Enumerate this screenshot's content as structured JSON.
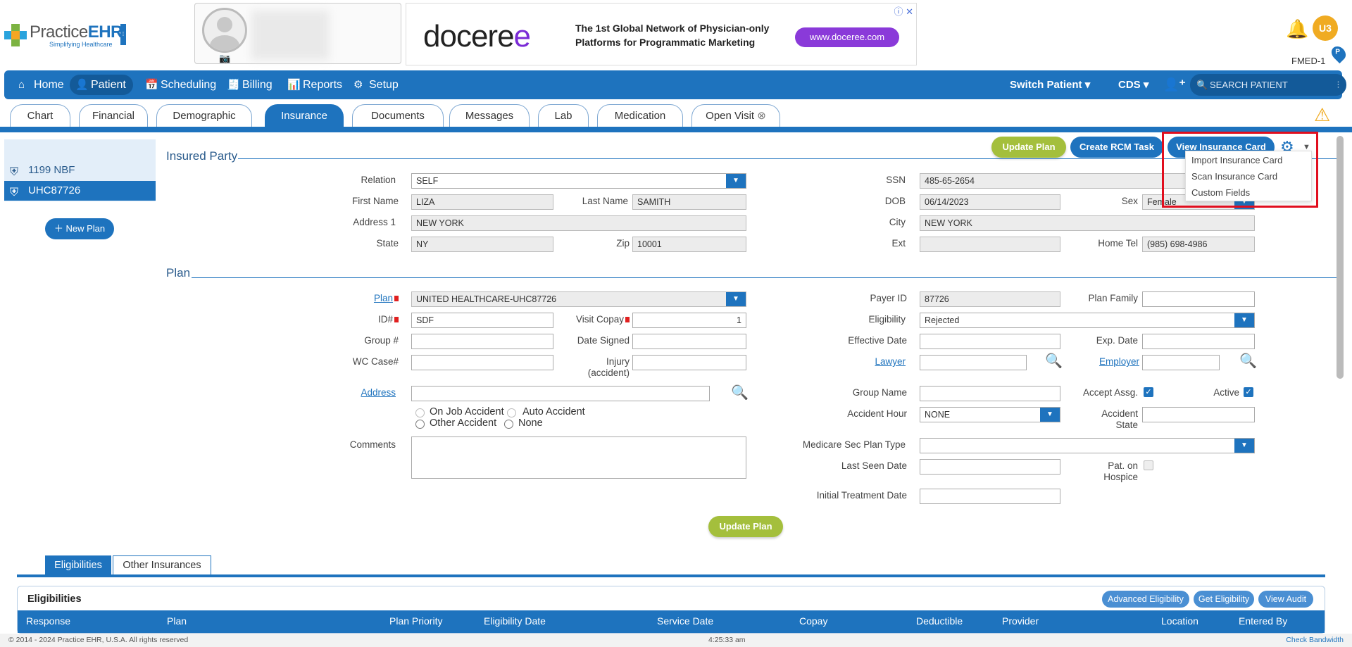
{
  "logo": {
    "name_a": "Practice",
    "name_b": "EHR",
    "tagline": "Simplifying Healthcare"
  },
  "ad": {
    "brand_a": "docere",
    "brand_b": "e",
    "line1": "The 1st Global Network of Physician-only",
    "line2": "Platforms for Programmatic Marketing",
    "cta": "www.doceree.com"
  },
  "user": {
    "initials": "U3",
    "facility": "FMED-1",
    "pin": "P"
  },
  "nav": {
    "items": [
      {
        "label": "Home",
        "icon": "home-icon"
      },
      {
        "label": "Patient",
        "icon": "user-icon"
      },
      {
        "label": "Scheduling",
        "icon": "calendar-icon"
      },
      {
        "label": "Billing",
        "icon": "billing-icon"
      },
      {
        "label": "Reports",
        "icon": "chart-icon"
      },
      {
        "label": "Setup",
        "icon": "setup-icon"
      }
    ],
    "switch_patient": "Switch Patient",
    "cds": "CDS",
    "search_placeholder": "SEARCH PATIENT"
  },
  "tabs": [
    "Chart",
    "Financial",
    "Demographic",
    "Insurance",
    "Documents",
    "Messages",
    "Lab",
    "Medication",
    "Open Visit"
  ],
  "plans": [
    "1199 NBF",
    "UHC87726"
  ],
  "new_plan": "New Plan",
  "buttons": {
    "update_plan": "Update Plan",
    "create_rcm": "Create RCM Task",
    "view_card": "View Insurance Card"
  },
  "gear_menu": [
    "Import Insurance Card",
    "Scan Insurance Card",
    "Custom Fields"
  ],
  "insured": {
    "section": "Insured Party",
    "relation_label": "Relation",
    "relation": "SELF",
    "first_label": "First Name",
    "first": "LIZA",
    "last_label": "Last Name",
    "last": "SAMITH",
    "addr_label": "Address 1",
    "addr": "NEW YORK",
    "state_label": "State",
    "state": "NY",
    "zip_label": "Zip",
    "zip": "10001",
    "ssn_label": "SSN",
    "ssn": "485-65-2654",
    "dob_label": "DOB",
    "dob": "06/14/2023",
    "sex_label": "Sex",
    "sex": "Female",
    "city_label": "City",
    "city": "NEW YORK",
    "ext_label": "Ext",
    "ext": "",
    "tel_label": "Home Tel",
    "tel": "(985) 698-4986"
  },
  "plan": {
    "section": "Plan",
    "plan_label": "Plan",
    "plan": "UNITED HEALTHCARE-UHC87726",
    "id_label": "ID#",
    "id": "SDF",
    "copay_label": "Visit Copay",
    "copay": "1",
    "group_label": "Group #",
    "group": "",
    "signed_label": "Date Signed",
    "wc_label": "WC Case#",
    "injury_label1": "Injury",
    "injury_label2": "(accident)",
    "address_label": "Address",
    "rad_job": "On Job Accident",
    "rad_auto": "Auto Accident",
    "rad_other": "Other Accident",
    "rad_none": "None",
    "comments_label": "Comments",
    "payer_label": "Payer ID",
    "payer": "87726",
    "family_label": "Plan Family",
    "elig_label": "Eligibility",
    "elig": "Rejected",
    "eff_label": "Effective Date",
    "exp_label": "Exp. Date",
    "lawyer_label": "Lawyer",
    "employer_label": "Employer",
    "groupname_label": "Group Name",
    "accept_label": "Accept Assg.",
    "active_label": "Active",
    "hour_label": "Accident Hour",
    "hour": "NONE",
    "astate_label1": "Accident",
    "astate_label2": "State",
    "medicare_label": "Medicare Sec Plan Type",
    "lastseen_label": "Last Seen Date",
    "hospice_label1": "Pat. on",
    "hospice_label2": "Hospice",
    "initial_label": "Initial Treatment Date"
  },
  "bottom": {
    "tabs": [
      "Eligibilities",
      "Other Insurances"
    ],
    "title": "Eligibilities",
    "buttons": [
      "Advanced Eligibility",
      "Get Eligibility",
      "View Audit"
    ],
    "columns": [
      "Response",
      "Plan",
      "Plan Priority",
      "Eligibility Date",
      "Service Date",
      "Copay",
      "Deductible",
      "Provider",
      "Location",
      "Entered By"
    ]
  },
  "footer": {
    "copyright": "© 2014 - 2024 Practice EHR, U.S.A. All rights reserved",
    "time": "4:25:33 am",
    "bandwidth": "Check Bandwidth"
  }
}
